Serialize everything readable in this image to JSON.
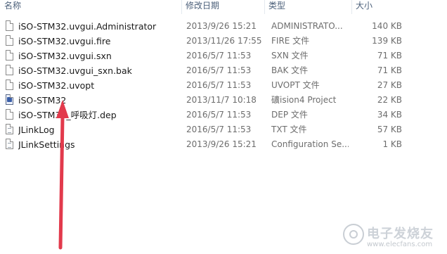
{
  "columns": {
    "name": "名称",
    "date": "修改日期",
    "type": "类型",
    "size": "大小"
  },
  "files": [
    {
      "name": "iSO-STM32.uvgui.Administrator",
      "date": "2013/9/26 15:21",
      "type": "ADMINISTRATO...",
      "size": "140 KB",
      "icon": "document-icon"
    },
    {
      "name": "iSO-STM32.uvgui.fire",
      "date": "2013/11/26 17:55",
      "type": "FIRE 文件",
      "size": "139 KB",
      "icon": "document-icon"
    },
    {
      "name": "iSO-STM32.uvgui.sxn",
      "date": "2016/5/7 11:53",
      "type": "SXN 文件",
      "size": "71 KB",
      "icon": "document-icon"
    },
    {
      "name": "iSO-STM32.uvgui_sxn.bak",
      "date": "2016/5/7 11:53",
      "type": "BAK 文件",
      "size": "71 KB",
      "icon": "document-icon"
    },
    {
      "name": "iSO-STM32.uvopt",
      "date": "2016/5/7 11:53",
      "type": "UVOPT 文件",
      "size": "27 KB",
      "icon": "document-icon"
    },
    {
      "name": "iSO-STM32",
      "date": "2013/11/7 10:18",
      "type": "礦ision4 Project",
      "size": "22 KB",
      "icon": "keil-project-icon"
    },
    {
      "name": "iSO-STM32_呼吸灯.dep",
      "date": "2016/5/7 11:53",
      "type": "DEP 文件",
      "size": "34 KB",
      "icon": "document-icon"
    },
    {
      "name": "JLinkLog",
      "date": "2016/5/7 11:53",
      "type": "TXT 文件",
      "size": "57 KB",
      "icon": "text-document-icon"
    },
    {
      "name": "JLinkSettings",
      "date": "2013/9/26 15:21",
      "type": "Configuration Se...",
      "size": "1 KB",
      "icon": "text-document-icon"
    }
  ],
  "watermark": {
    "title": "电子发烧友",
    "url": "www.elecfans.com"
  },
  "colors": {
    "arrow": "#e23a4c",
    "header_text": "#4c607a"
  }
}
